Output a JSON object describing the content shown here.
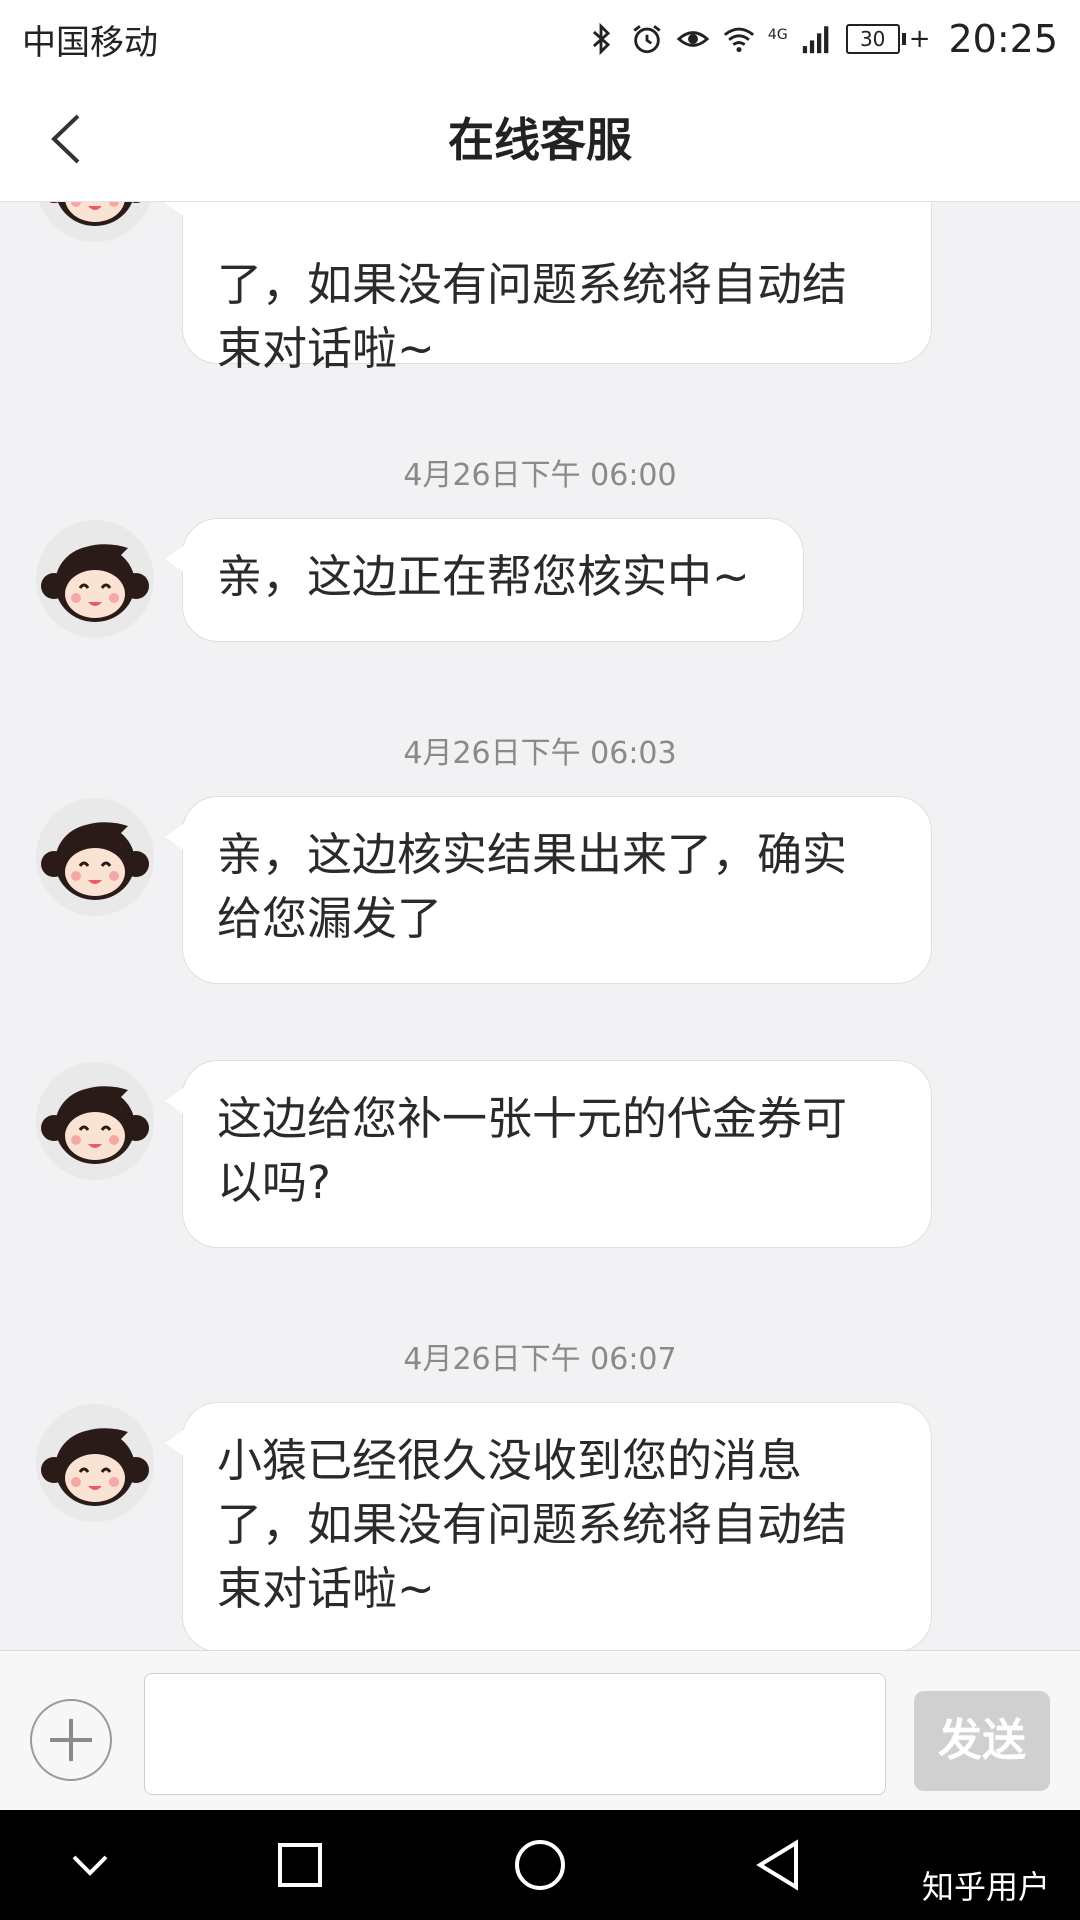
{
  "status_bar": {
    "carrier": "中国移动",
    "network": "4G",
    "battery": "30",
    "time": "20:25"
  },
  "header": {
    "title": "在线客服"
  },
  "messages": [
    {
      "text_line1": "了，如果没有问题系统将自动结",
      "text_line2": "束对话啦~"
    },
    {
      "timestamp": "4月26日下午  06:00",
      "text_line1": "亲，这边正在帮您核实中~"
    },
    {
      "timestamp": "4月26日下午  06:03",
      "text_line1": "亲，这边核实结果出来了，确实",
      "text_line2": "给您漏发了"
    },
    {
      "text_line1": "这边给您补一张十元的代金券可",
      "text_line2": "以吗?"
    },
    {
      "timestamp": "4月26日下午  06:07",
      "text_line1": "小猿已经很久没收到您的消息",
      "text_line2": "了，如果没有问题系统将自动结",
      "text_line3": "束对话啦~"
    }
  ],
  "input_bar": {
    "placeholder": "",
    "send_label": "发送"
  },
  "nav_bar": {
    "watermark": "知乎用户"
  },
  "icons": {
    "back": "chevron-left-icon",
    "plus": "plus-icon",
    "nav_down": "chevron-down-icon",
    "nav_recent": "square-icon",
    "nav_home": "circle-icon",
    "nav_back": "triangle-back-icon"
  },
  "colors": {
    "background": "#f2f2f4",
    "bubble": "#ffffff",
    "send_disabled": "#d0d0d0"
  }
}
